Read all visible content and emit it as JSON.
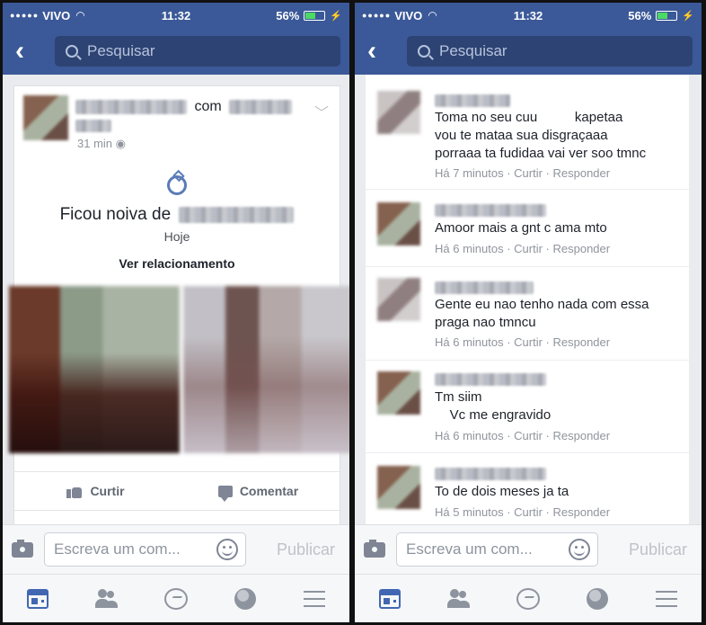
{
  "status_bar": {
    "carrier": "VIVO",
    "signal": "●●●●●",
    "time": "11:32",
    "battery": "56%",
    "battery_level": 0.56
  },
  "nav": {
    "search_placeholder": "Pesquisar"
  },
  "post": {
    "connector": "com",
    "time": "31 min",
    "life_event_title": "Ficou noiva de",
    "life_event_date": "Hoje",
    "view_relationship": "Ver relacionamento",
    "like_label": "Curtir",
    "comment_label": "Comentar"
  },
  "comments": [
    {
      "text": "Toma no seu cuu          kapetaa\nvou te mataa sua disgraçaaa\nporraaa ta fudidaa vai ver soo tmnc",
      "time": "Há 7 minutos",
      "like": "Curtir",
      "reply": "Responder"
    },
    {
      "text": "Amoor mais a gnt c ama mto",
      "time": "Há 6 minutos",
      "like": "Curtir",
      "reply": "Responder"
    },
    {
      "text": "Gente eu nao tenho nada com essa\npraga nao tmncu",
      "time": "Há 6 minutos",
      "like": "Curtir",
      "reply": "Responder"
    },
    {
      "text": "Tm siim\n    Vc me engravido",
      "time": "Há 6 minutos",
      "like": "Curtir",
      "reply": "Responder"
    },
    {
      "text": "To de dois meses ja ta",
      "time": "Há 5 minutos",
      "like": "Curtir",
      "reply": "Responder"
    }
  ],
  "composer": {
    "placeholder": "Escreva um com...",
    "publish": "Publicar"
  },
  "colors": {
    "brand": "#3b5998",
    "tab_active": "#4267b2"
  },
  "icons": [
    "back-arrow-icon",
    "search-icon",
    "chevron-down-icon",
    "globe-icon",
    "ring-icon",
    "like-icon",
    "comment-icon",
    "camera-icon",
    "emoji-icon",
    "news-feed-icon",
    "friends-icon",
    "messenger-icon",
    "notifications-globe-icon",
    "menu-icon"
  ]
}
